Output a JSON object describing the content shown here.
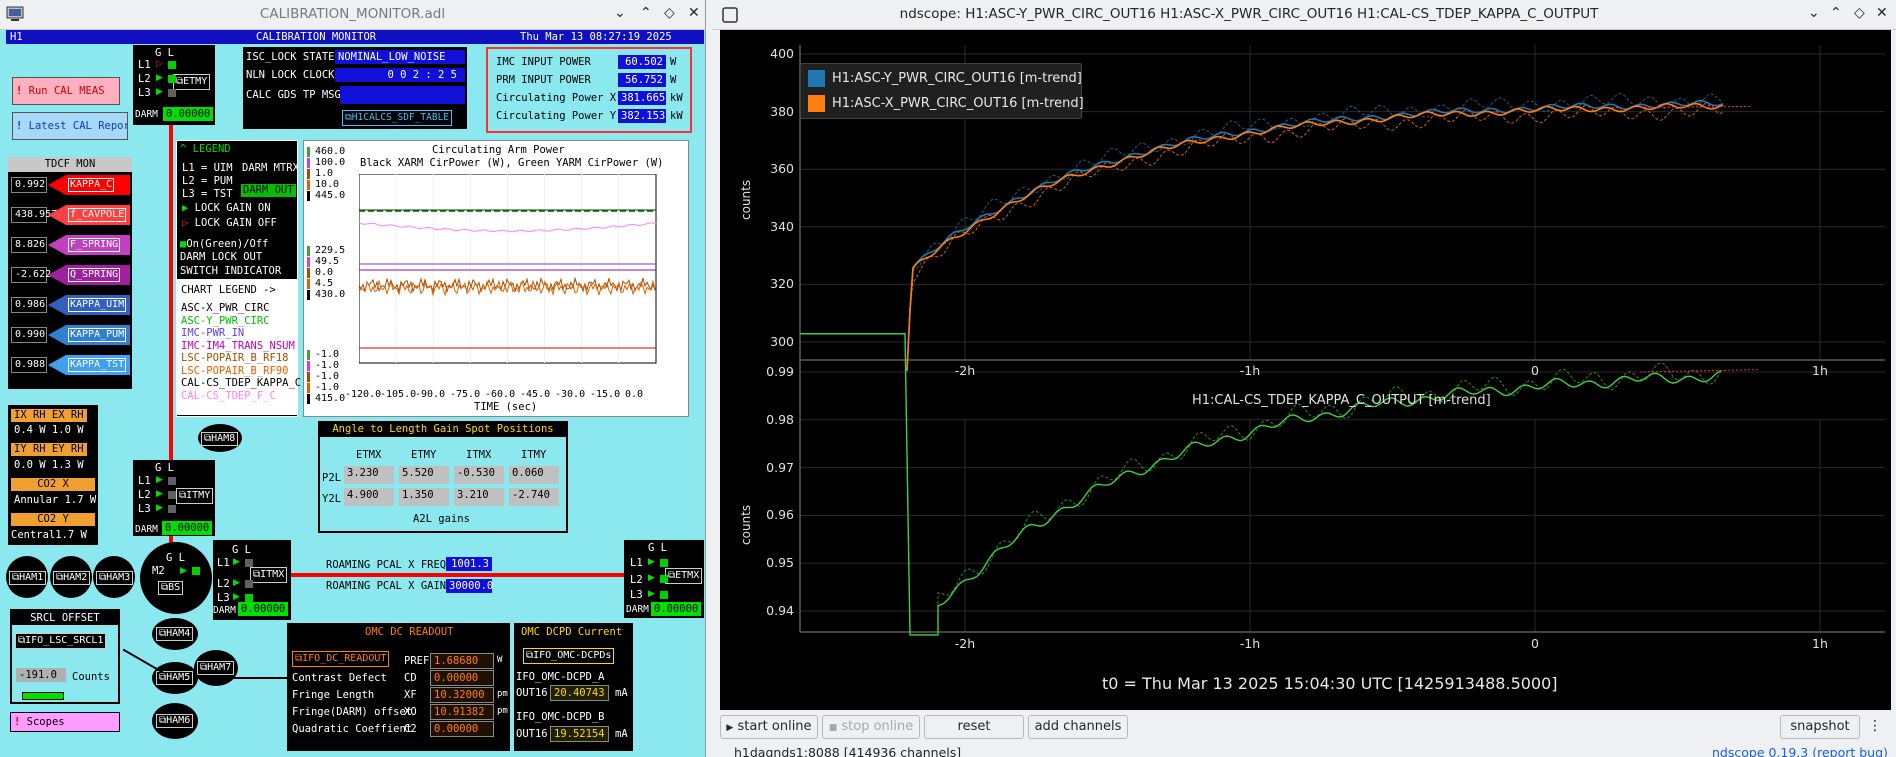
{
  "left": {
    "title": "CALIBRATION_MONITOR.adl",
    "header": {
      "site": "H1",
      "name": "CALIBRATION MONITOR",
      "date": "Thu Mar 13 08:27:19 2025"
    },
    "run_cal": "Run CAL MEAS",
    "latest_cal": "Latest CAL Report",
    "tdcf": {
      "title": "TDCF MON",
      "rows": [
        {
          "value": "0.992",
          "label": "KAPPA_C",
          "color": "#ff0000"
        },
        {
          "value": "438.957",
          "label": "f_CAVPOLE",
          "color": "#ff4040"
        },
        {
          "value": "8.826",
          "label": "F_SPRING",
          "color": "#c040c0"
        },
        {
          "value": "-2.622",
          "label": "Q_SPRING",
          "color": "#a020a0"
        },
        {
          "value": "0.986",
          "label": "KAPPA_UIM",
          "color": "#3060c0"
        },
        {
          "value": "0.990",
          "label": "KAPPA_PUM",
          "color": "#3080d0"
        },
        {
          "value": "0.988",
          "label": "KAPPA_TST",
          "color": "#40a0f0"
        }
      ]
    },
    "isc": {
      "state_label": "ISC_LOCK STATE",
      "state": "NOMINAL_LOW_NOISE",
      "clock_label": "NLN LOCK CLOCK",
      "clock": "0 0 2 : 2 5",
      "gds_label": "CALC GDS TP MSG",
      "gds": "",
      "sdf": "H1CALCS_SDF_TABLE"
    },
    "power": {
      "rows": [
        {
          "label": "IMC INPUT POWER",
          "value": "60.502",
          "unit": "W"
        },
        {
          "label": "PRM INPUT POWER",
          "value": "56.752",
          "unit": "W"
        },
        {
          "label": "Circulating Power X",
          "value": "381.665",
          "unit": "kW"
        },
        {
          "label": "Circulating Power Y",
          "value": "382.153",
          "unit": "kW"
        }
      ]
    },
    "etmy": {
      "gl": "G L",
      "l1": "L1",
      "l2": "L2",
      "l3": "L3",
      "btn": "ETMY",
      "darm": "DARM",
      "val": "0.00000"
    },
    "itmy": {
      "gl": "G L",
      "l1": "L1",
      "l2": "L2",
      "l3": "L3",
      "btn": "ITMY",
      "darm": "DARM",
      "val": "0.00000"
    },
    "itmx": {
      "gl": "G L",
      "l1": "L1",
      "l2": "L2",
      "l3": "L3",
      "btn": "ITMX",
      "darm": "DARM",
      "val": "0.00000"
    },
    "etmx": {
      "gl": "G L",
      "l1": "L1",
      "l2": "L2",
      "l3": "L3",
      "btn": "ETMX",
      "darm": "DARM",
      "val": "0.00000"
    },
    "bs": {
      "gl": "G L",
      "m2": "M2",
      "btn": "BS"
    },
    "legend": {
      "title": "LEGEND",
      "l1": "L1 = UIM",
      "l2": "L2 = PUM",
      "l3": "L3 = TST",
      "darm_mtrx": "DARM MTRX",
      "darm_out": "DARM OUT",
      "lock_on": "LOCK GAIN ON",
      "lock_off": "LOCK GAIN OFF",
      "ongreen": "On(Green)/Off",
      "darm_lock": "DARM LOCK OUT",
      "switch": "SWITCH INDICATOR",
      "chart_legend": "CHART LEGEND  ->",
      "channels": [
        {
          "name": "ASC-X_PWR_CIRC",
          "color": "#000000"
        },
        {
          "name": "ASC-Y_PWR_CIRC",
          "color": "#00c000"
        },
        {
          "name": "IMC-PWR_IN",
          "color": "#6040e0"
        },
        {
          "name": "IMC-IM4_TRANS_NSUM",
          "color": "#c000c0"
        },
        {
          "name": "LSC-POPAIR_B_RF18",
          "color": "#a05000"
        },
        {
          "name": "LSC-POPAIR_B_RF90",
          "color": "#e06000"
        },
        {
          "name": "CAL-CS_TDEP_KAPPA_C",
          "color": "#000000"
        },
        {
          "name": "CAL-CS_TDEP_F_C",
          "color": "#ff80ff"
        }
      ]
    },
    "chart": {
      "title": "Circulating Arm Power",
      "subtitle": "Black XARM CirPower (W), Green YARM CirPower (W)",
      "xlabel": "TIME (sec)",
      "xticks": [
        "-120.0",
        "-105.0",
        "-90.0",
        "-75.0",
        "-60.0",
        "-45.0",
        "-30.0",
        "-15.0",
        "0.0"
      ],
      "axis1": [
        "460.0",
        "100.0",
        "1.0",
        "10.0",
        "445.0"
      ],
      "axis2": [
        "229.5",
        "49.5",
        "0.0",
        "4.5",
        "430.0"
      ],
      "axis3": [
        "-1.0",
        "-1.0",
        "-1.0",
        "-1.0",
        "415.0"
      ]
    },
    "a2l": {
      "title": "Angle to Length Gain Spot Positions",
      "cols": [
        "ETMX",
        "ETMY",
        "ITMX",
        "ITMY"
      ],
      "rows": [
        {
          "label": "P2L",
          "values": [
            "3.230",
            "5.520",
            "-0.530",
            "0.060"
          ]
        },
        {
          "label": "Y2L",
          "values": [
            "4.900",
            "1.350",
            "3.210",
            "-2.740"
          ]
        }
      ],
      "footer": "A2L gains"
    },
    "rh": {
      "ix": "IX RH EX RH",
      "ix_vals": "0.4 W 1.0  W",
      "iy": "IY RH EY RH",
      "iy_vals": "0.0 W  1.3 W",
      "co2x": "CO2 X",
      "annular": "Annular 1.7 W",
      "co2y": "CO2 Y",
      "central": "Central1.7  W"
    },
    "hams": [
      "HAM1",
      "HAM2",
      "HAM3",
      "HAM4",
      "HAM5",
      "HAM6",
      "HAM7",
      "HAM8"
    ],
    "srcl": {
      "title": "SRCL OFFSET",
      "btn": "IFO_LSC_SRCL1",
      "value": "-191.0",
      "unit": "Counts"
    },
    "scopes": "Scopes",
    "pcal": {
      "freq_label": "ROAMING PCAL X FREQ",
      "freq": "1001.3",
      "gain_label": "ROAMING PCAL X GAIN",
      "gain": "30000.0"
    },
    "omc": {
      "title": "OMC DC READOUT",
      "btn": "IFO_DC_READOUT",
      "rows": [
        {
          "label": "",
          "tag": "PREF",
          "value": "1.68680",
          "unit": "W"
        },
        {
          "label": "Contrast Defect",
          "tag": "CD",
          "value": "0.00000",
          "unit": ""
        },
        {
          "label": "Fringe Length",
          "tag": "XF",
          "value": "10.32000",
          "unit": "pm"
        },
        {
          "label": "Fringe(DARM) offset",
          "tag": "XO",
          "value": "10.91382",
          "unit": "pm"
        },
        {
          "label": "Quadratic Coeffient",
          "tag": "C2",
          "value": "0.00000",
          "unit": ""
        }
      ]
    },
    "dcpd": {
      "title": "OMC DCPD Current",
      "btn": "IFO_OMC-DCPDs",
      "a_label": "IFO_OMC-DCPD_A",
      "a_tag": "OUT16",
      "a_val": "20.40743",
      "unit": "mA",
      "b_label": "IFO_OMC-DCPD_B",
      "b_tag": "OUT16",
      "b_val": "19.52154"
    }
  },
  "right": {
    "title": "ndscope: H1:ASC-Y_PWR_CIRC_OUT16 H1:ASC-X_PWR_CIRC_OUT16 H1:CAL-CS_TDEP_KAPPA_C_OUTPUT",
    "plot1": {
      "ylabel": "counts",
      "yticks": [
        "400",
        "380",
        "360",
        "340",
        "320",
        "300"
      ],
      "xticks": [
        "-2h",
        "-1h",
        "0",
        "1h"
      ],
      "legend": [
        {
          "name": "H1:ASC-Y_PWR_CIRC_OUT16 [m-trend]",
          "color": "#1f77b4"
        },
        {
          "name": "H1:ASC-X_PWR_CIRC_OUT16 [m-trend]",
          "color": "#ff7f0e"
        }
      ]
    },
    "plot2": {
      "title": "H1:CAL-CS_TDEP_KAPPA_C_OUTPUT [m-trend]",
      "ylabel": "counts",
      "yticks": [
        "0.99",
        "0.98",
        "0.97",
        "0.96",
        "0.95",
        "0.94"
      ],
      "xticks": [
        "-2h",
        "-1h",
        "0",
        "1h"
      ]
    },
    "t0": "t0 = Thu Mar 13 2025 15:04:30 UTC [1425913488.5000]",
    "buttons": {
      "start": "start online",
      "stop": "stop online",
      "reset": "reset",
      "add": "add channels",
      "snapshot": "snapshot"
    },
    "status": "h1dagnds1:8088  [414936 channels]",
    "version": "ndscope 0.19.3 (report bug)"
  }
}
